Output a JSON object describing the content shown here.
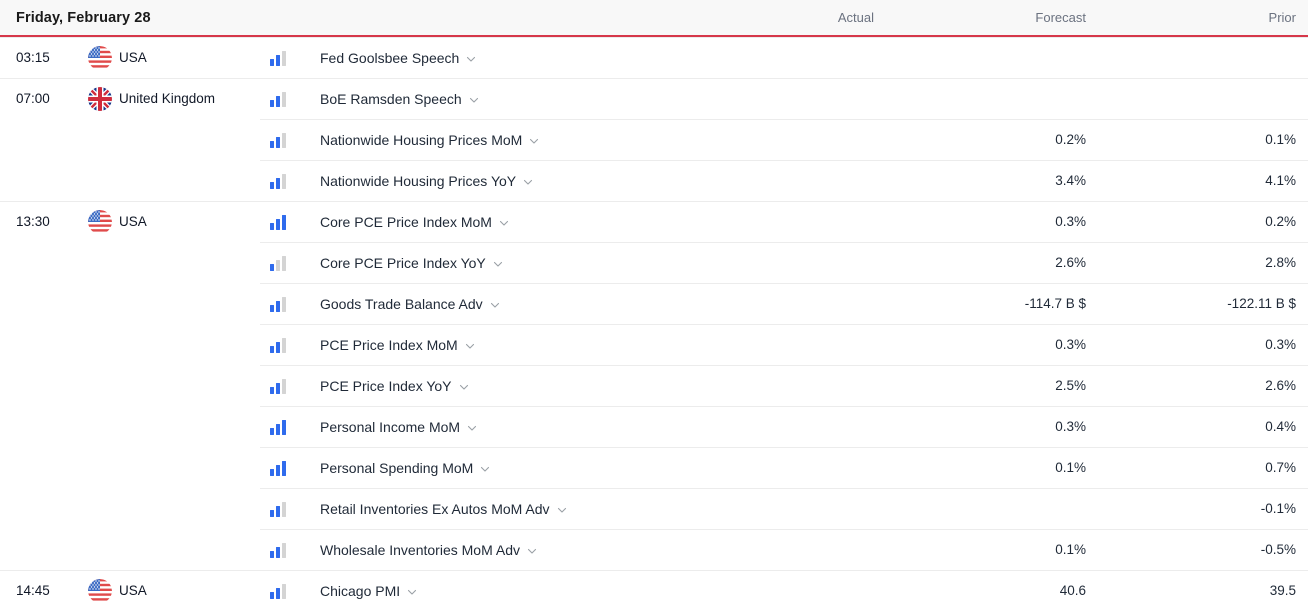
{
  "header": {
    "date": "Friday, February 28",
    "columns": {
      "actual": "Actual",
      "forecast": "Forecast",
      "prior": "Prior"
    },
    "accent_color": "#d6374a",
    "background": "#f8f8f8"
  },
  "theme": {
    "impact_active_color": "#2f6bed",
    "impact_inactive_color": "#d4d4d4",
    "row_divider_color": "#ececec",
    "text_color": "#1f2937",
    "muted_text_color": "#6b7280"
  },
  "rows": [
    {
      "time": "03:15",
      "country": "USA",
      "flag": "flag-usa",
      "group_start": true,
      "impact": 2,
      "event": "Fed Goolsbee Speech",
      "actual": "",
      "forecast": "",
      "prior": ""
    },
    {
      "time": "07:00",
      "country": "United Kingdom",
      "flag": "flag-uk",
      "group_start": true,
      "impact": 2,
      "event": "BoE Ramsden Speech",
      "actual": "",
      "forecast": "",
      "prior": ""
    },
    {
      "time": "",
      "country": "",
      "flag": "",
      "group_start": false,
      "impact": 2,
      "event": "Nationwide Housing Prices MoM",
      "actual": "",
      "forecast": "0.2%",
      "prior": "0.1%"
    },
    {
      "time": "",
      "country": "",
      "flag": "",
      "group_start": false,
      "impact": 2,
      "event": "Nationwide Housing Prices YoY",
      "actual": "",
      "forecast": "3.4%",
      "prior": "4.1%"
    },
    {
      "time": "13:30",
      "country": "USA",
      "flag": "flag-usa",
      "group_start": true,
      "impact": 3,
      "event": "Core PCE Price Index MoM",
      "actual": "",
      "forecast": "0.3%",
      "prior": "0.2%"
    },
    {
      "time": "",
      "country": "",
      "flag": "",
      "group_start": false,
      "impact": 1,
      "event": "Core PCE Price Index YoY",
      "actual": "",
      "forecast": "2.6%",
      "prior": "2.8%"
    },
    {
      "time": "",
      "country": "",
      "flag": "",
      "group_start": false,
      "impact": 2,
      "event": "Goods Trade Balance Adv",
      "actual": "",
      "forecast": "-114.7 B $",
      "prior": "-122.11 B $"
    },
    {
      "time": "",
      "country": "",
      "flag": "",
      "group_start": false,
      "impact": 2,
      "event": "PCE Price Index MoM",
      "actual": "",
      "forecast": "0.3%",
      "prior": "0.3%"
    },
    {
      "time": "",
      "country": "",
      "flag": "",
      "group_start": false,
      "impact": 2,
      "event": "PCE Price Index YoY",
      "actual": "",
      "forecast": "2.5%",
      "prior": "2.6%"
    },
    {
      "time": "",
      "country": "",
      "flag": "",
      "group_start": false,
      "impact": 3,
      "event": "Personal Income MoM",
      "actual": "",
      "forecast": "0.3%",
      "prior": "0.4%"
    },
    {
      "time": "",
      "country": "",
      "flag": "",
      "group_start": false,
      "impact": 3,
      "event": "Personal Spending MoM",
      "actual": "",
      "forecast": "0.1%",
      "prior": "0.7%"
    },
    {
      "time": "",
      "country": "",
      "flag": "",
      "group_start": false,
      "impact": 2,
      "event": "Retail Inventories Ex Autos MoM Adv",
      "actual": "",
      "forecast": "",
      "prior": "-0.1%"
    },
    {
      "time": "",
      "country": "",
      "flag": "",
      "group_start": false,
      "impact": 2,
      "event": "Wholesale Inventories MoM Adv",
      "actual": "",
      "forecast": "0.1%",
      "prior": "-0.5%"
    },
    {
      "time": "14:45",
      "country": "USA",
      "flag": "flag-usa",
      "group_start": true,
      "impact": 2,
      "event": "Chicago PMI",
      "actual": "",
      "forecast": "40.6",
      "prior": "39.5"
    }
  ]
}
